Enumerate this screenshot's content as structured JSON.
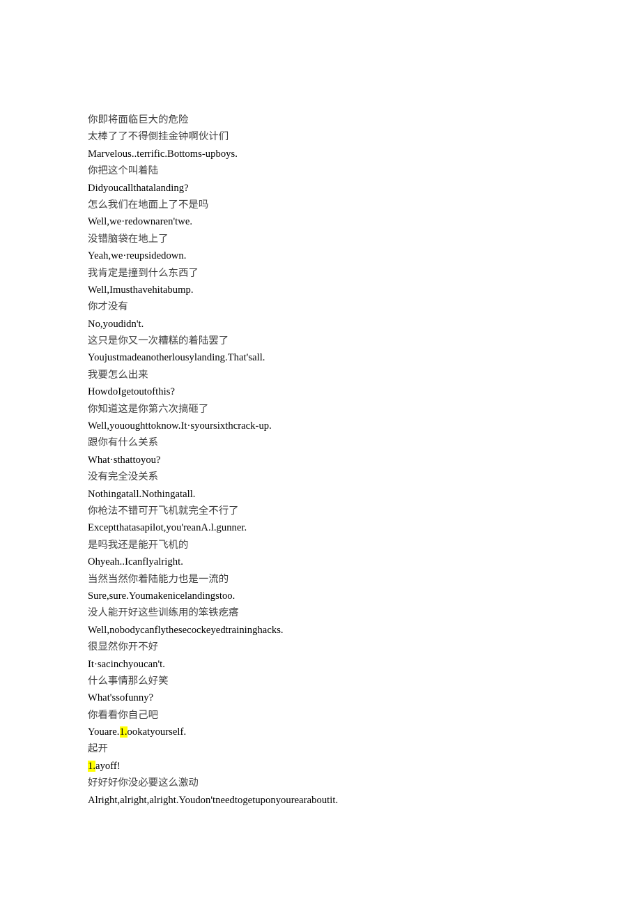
{
  "document": {
    "background_color": "#ffffff",
    "text_color_chinese": "#3f3f3f",
    "text_color_english": "#000000",
    "highlight_color": "#ffff00",
    "lines": [
      {
        "lang": "zh",
        "text": "你即将面临巨大的危险"
      },
      {
        "lang": "zh",
        "text": "太棒了了不得倒挂金钟啊伙计们"
      },
      {
        "lang": "en",
        "text": "Marvelous..terrific.Bottoms-upboys."
      },
      {
        "lang": "zh",
        "text": "你把这个叫着陆"
      },
      {
        "lang": "en",
        "text": "Didyoucallthatalanding?"
      },
      {
        "lang": "zh",
        "text": "怎么我们在地面上了不是吗"
      },
      {
        "lang": "en",
        "text": "Well,we·redownaren'twe."
      },
      {
        "lang": "zh",
        "text": "没错脑袋在地上了"
      },
      {
        "lang": "en",
        "text": "Yeah,we·reupsidedown."
      },
      {
        "lang": "zh",
        "text": "我肯定是撞到什么东西了"
      },
      {
        "lang": "en",
        "text": "Well,Imusthavehitabump."
      },
      {
        "lang": "zh",
        "text": "你才没有"
      },
      {
        "lang": "en",
        "text": "No,youdidn't."
      },
      {
        "lang": "zh",
        "text": "这只是你又一次糟糕的着陆罢了"
      },
      {
        "lang": "en",
        "text": "Youjustmadeanotherlousylanding.That'sall."
      },
      {
        "lang": "zh",
        "text": "我要怎么出来"
      },
      {
        "lang": "en",
        "text": "HowdoIgetoutofthis?"
      },
      {
        "lang": "zh",
        "text": "你知道这是你第六次搞砸了"
      },
      {
        "lang": "en",
        "text": "Well,yououghttoknow.It·syoursixthcrack-up."
      },
      {
        "lang": "zh",
        "text": "跟你有什么关系"
      },
      {
        "lang": "en",
        "text": "What·sthattoyou?"
      },
      {
        "lang": "zh",
        "text": "没有完全没关系"
      },
      {
        "lang": "en",
        "text": "Nothingatall.Nothingatall."
      },
      {
        "lang": "zh",
        "text": "你枪法不错可开飞机就完全不行了"
      },
      {
        "lang": "en",
        "text": "Exceptthatasapilot,you'reanA.l.gunner."
      },
      {
        "lang": "zh",
        "text": "是吗我还是能开飞机的"
      },
      {
        "lang": "en",
        "text": "Ohyeah..Icanflyalright."
      },
      {
        "lang": "zh",
        "text": "当然当然你着陆能力也是一流的"
      },
      {
        "lang": "en",
        "text": "Sure,sure.Youmakenicelandingstoo."
      },
      {
        "lang": "zh",
        "text": "没人能开好这些训练用的笨铁疙瘩"
      },
      {
        "lang": "en",
        "text": "Well,nobodycanflythesecockeyedtraininghacks."
      },
      {
        "lang": "zh",
        "text": "很显然你开不好"
      },
      {
        "lang": "en",
        "text": "It·sacinchyoucan't."
      },
      {
        "lang": "zh",
        "text": "什么事情那么好笑"
      },
      {
        "lang": "en",
        "text": "What'ssofunny?"
      },
      {
        "lang": "zh",
        "text": "你看看你自己吧"
      },
      {
        "lang": "en",
        "segments": [
          {
            "text": "Youare."
          },
          {
            "text": "1.",
            "highlight": true
          },
          {
            "text": "ookatyourself."
          }
        ]
      },
      {
        "lang": "zh",
        "text": "起开"
      },
      {
        "lang": "en",
        "segments": [
          {
            "text": "1.",
            "highlight": true
          },
          {
            "text": "ayoff!"
          }
        ]
      },
      {
        "lang": "zh",
        "text": "好好好你没必要这么激动"
      },
      {
        "lang": "en",
        "text": "Alright,alright,alright.Youdon'tneedtogetuponyourearaboutit."
      }
    ]
  }
}
